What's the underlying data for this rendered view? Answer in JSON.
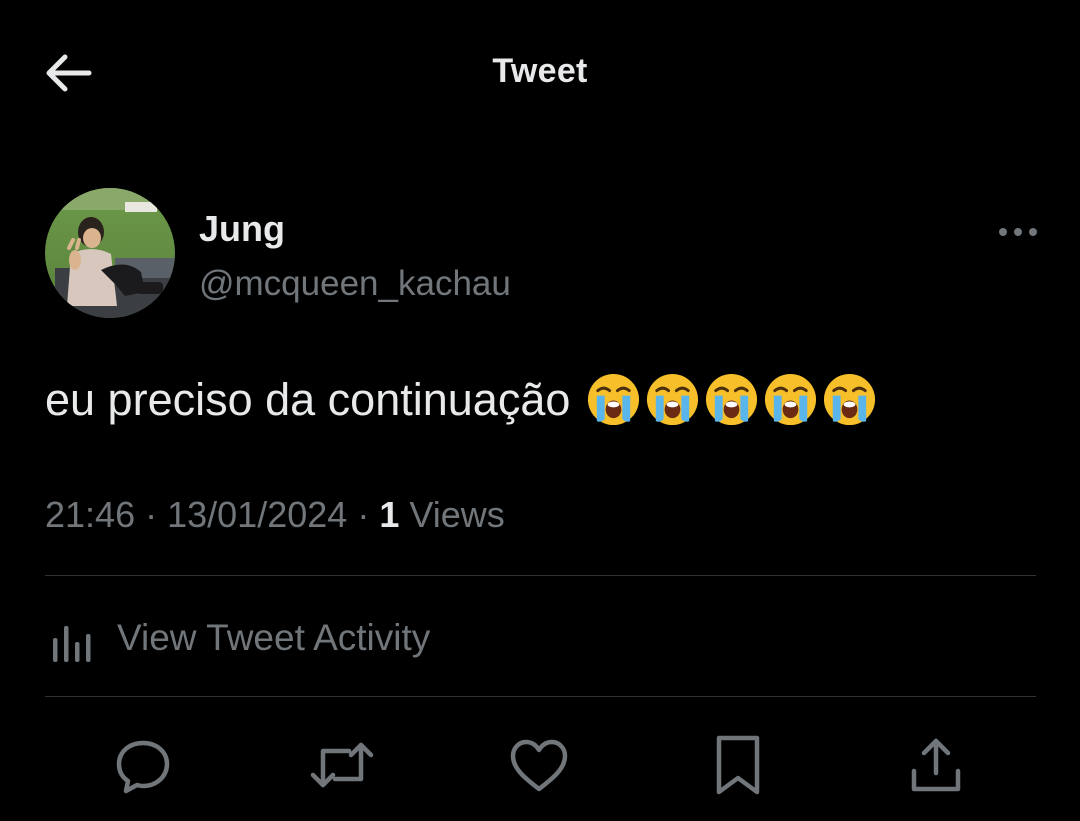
{
  "header": {
    "title": "Tweet",
    "back_icon": "arrow-left-icon"
  },
  "author": {
    "display_name": "Jung",
    "handle": "@mcqueen_kachau",
    "avatar_icon": "avatar-photo"
  },
  "tweet": {
    "text": "eu preciso da continuação",
    "emojis": [
      "loudly-crying-face",
      "loudly-crying-face",
      "loudly-crying-face",
      "loudly-crying-face",
      "loudly-crying-face"
    ],
    "time": "21:46",
    "separator": "·",
    "date": "13/01/2024",
    "views_count": "1",
    "views_label": "Views"
  },
  "activity": {
    "label": "View Tweet Activity",
    "icon": "bar-chart-icon"
  },
  "actions": [
    {
      "name": "reply",
      "icon": "reply-icon"
    },
    {
      "name": "retweet",
      "icon": "retweet-icon"
    },
    {
      "name": "like",
      "icon": "heart-icon"
    },
    {
      "name": "bookmark",
      "icon": "bookmark-icon"
    },
    {
      "name": "share",
      "icon": "share-icon"
    }
  ],
  "colors": {
    "background": "#000000",
    "primary_text": "#e7e9ea",
    "secondary_text": "#71767b",
    "divider": "#2f3336"
  }
}
